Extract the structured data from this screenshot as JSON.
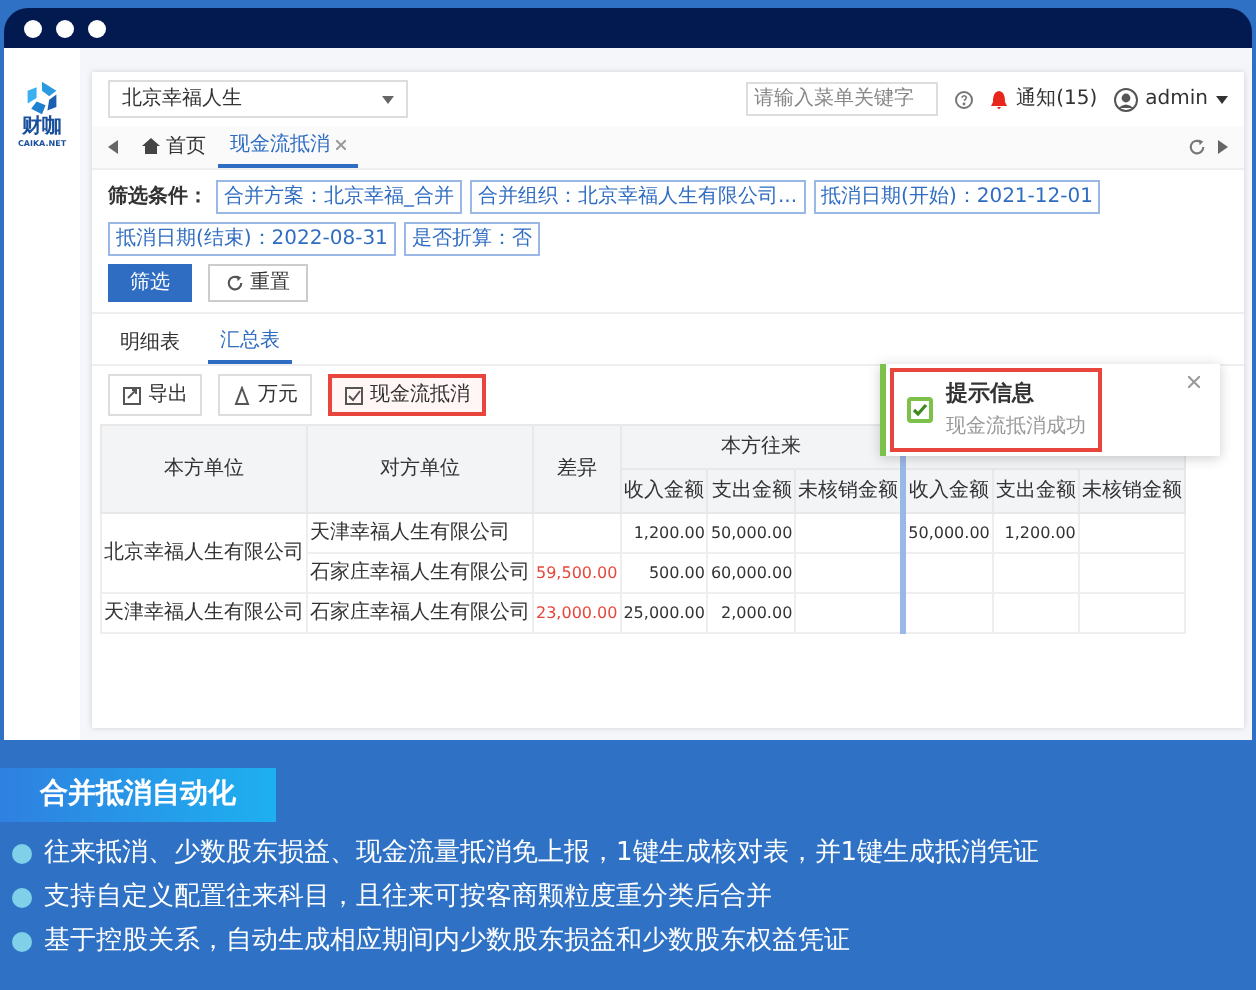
{
  "logo": {
    "name": "财咖",
    "domain": "CAIKA.NET"
  },
  "header": {
    "org": "北京幸福人生",
    "search_placeholder": "请输入菜单关键字",
    "notifications": "通知(15)",
    "user": "admin"
  },
  "tabs": [
    {
      "label": "首页",
      "kind": "home",
      "selected": false
    },
    {
      "label": "现金流抵消",
      "kind": "closable",
      "selected": true
    }
  ],
  "filter": {
    "label": "筛选条件：",
    "chips": [
      "合并方案：北京幸福_合并",
      "合并组织：北京幸福人生有限公司...",
      "抵消日期(开始)：2021-12-01",
      "抵消日期(结束)：2022-08-31",
      "是否折算：否"
    ],
    "buttons": [
      {
        "label": "筛选",
        "kind": "primary"
      },
      {
        "label": "重置",
        "kind": "reset"
      }
    ]
  },
  "view_tabs": [
    {
      "label": "明细表",
      "selected": false
    },
    {
      "label": "汇总表",
      "selected": true
    }
  ],
  "toolbar": [
    {
      "label": "导出",
      "kind": "export",
      "highlighted": false
    },
    {
      "label": "万元",
      "kind": "unit",
      "highlighted": false
    },
    {
      "label": "现金流抵消",
      "kind": "offset",
      "highlighted": true
    }
  ],
  "table": {
    "columns": {
      "own_unit": "本方单位",
      "counter_unit": "对方单位",
      "difference": "差异",
      "group": "本方往来",
      "sub": [
        "收入金额",
        "支出金额",
        "未核销金额"
      ],
      "right_sub": [
        "收入金额",
        "支出金额",
        "未核销金额"
      ]
    },
    "rows": [
      {
        "own_unit": "北京幸福人生有限公司",
        "counterparts": [
          {
            "counter_unit": "天津幸福人生有限公司",
            "income": "1,200.00",
            "expense": "50,000.00",
            "right_income": "50,000.00",
            "right_expense": "1,200.00"
          },
          {
            "counter_unit": "石家庄幸福人生有限公司",
            "difference": "59,500.00",
            "income": "500.00",
            "expense": "60,000.00"
          }
        ]
      },
      {
        "own_unit": "天津幸福人生有限公司",
        "counterparts": [
          {
            "counter_unit": "石家庄幸福人生有限公司",
            "difference": "23,000.00",
            "income": "25,000.00",
            "expense": "2,000.00"
          }
        ]
      }
    ]
  },
  "toast": {
    "title": "提示信息",
    "message": "现金流抵消成功",
    "highlighted": true
  },
  "feature": {
    "title": "合并抵消自动化",
    "bullets": [
      "往来抵消、少数股东损益、现金流量抵消免上报，1键生成核对表，并1键生成抵消凭证",
      "支持自定义配置往来科目，且往来可按客商颗粒度重分类后合并",
      "基于控股关系，自动生成相应期间内少数股东损益和少数股东权益凭证"
    ]
  }
}
